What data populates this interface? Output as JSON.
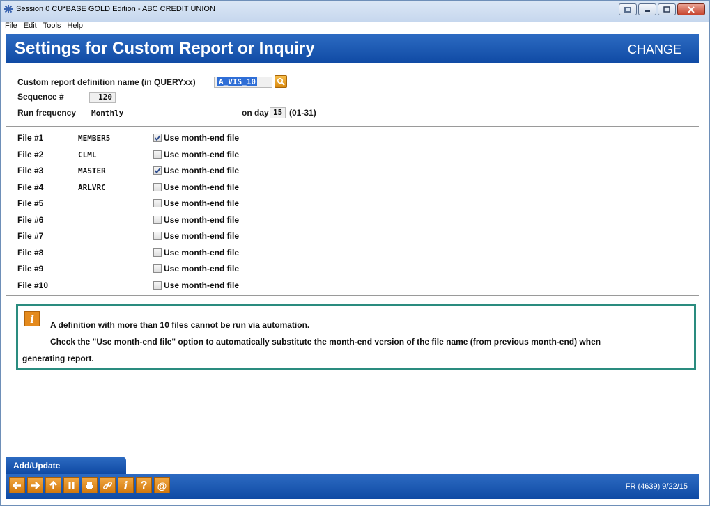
{
  "window": {
    "title": "Session 0 CU*BASE GOLD Edition - ABC CREDIT UNION",
    "menu": [
      "File",
      "Edit",
      "Tools",
      "Help"
    ]
  },
  "header": {
    "title": "Settings for Custom Report or Inquiry",
    "mode": "CHANGE"
  },
  "form": {
    "definition_label": "Custom report definition name (in QUERYxx)",
    "definition_value": "A_VIS_10",
    "sequence_label": "Sequence #",
    "sequence_value": "120",
    "frequency_label": "Run frequency",
    "frequency_value": "Monthly",
    "day_label": "on day",
    "day_value": "15",
    "day_hint": "(01-31)"
  },
  "files": [
    {
      "label": "File #1",
      "name": "MEMBER5",
      "checked": true,
      "option": "Use month-end file"
    },
    {
      "label": "File #2",
      "name": "CLML",
      "checked": false,
      "option": "Use month-end file"
    },
    {
      "label": "File #3",
      "name": "MASTER",
      "checked": true,
      "option": "Use month-end file"
    },
    {
      "label": "File #4",
      "name": "ARLVRC",
      "checked": false,
      "option": "Use month-end file"
    },
    {
      "label": "File #5",
      "name": "",
      "checked": false,
      "option": "Use month-end file"
    },
    {
      "label": "File #6",
      "name": "",
      "checked": false,
      "option": "Use month-end file"
    },
    {
      "label": "File #7",
      "name": "",
      "checked": false,
      "option": "Use month-end file"
    },
    {
      "label": "File #8",
      "name": "",
      "checked": false,
      "option": "Use month-end file"
    },
    {
      "label": "File #9",
      "name": "",
      "checked": false,
      "option": "Use month-end file"
    },
    {
      "label": "File #10",
      "name": "",
      "checked": false,
      "option": "Use month-end file"
    }
  ],
  "info": {
    "line1": "A definition with more than 10 files cannot be run via automation.",
    "line2": "Check the \"Use month-end file\" option to automatically substitute the month-end version of the file name (from previous month-end) when",
    "line3": "generating report."
  },
  "actions": {
    "add_update": "Add/Update"
  },
  "footer": {
    "buttons": [
      "back-icon",
      "forward-icon",
      "up-icon",
      "pause-icon",
      "print-icon",
      "link-icon",
      "info-icon",
      "help-icon",
      "email-icon"
    ],
    "code": "FR (4639) 9/22/15"
  },
  "colors": {
    "header_blue": "#1656b3",
    "teal_border": "#2a8c7f",
    "orange_button": "#e48a1d"
  }
}
